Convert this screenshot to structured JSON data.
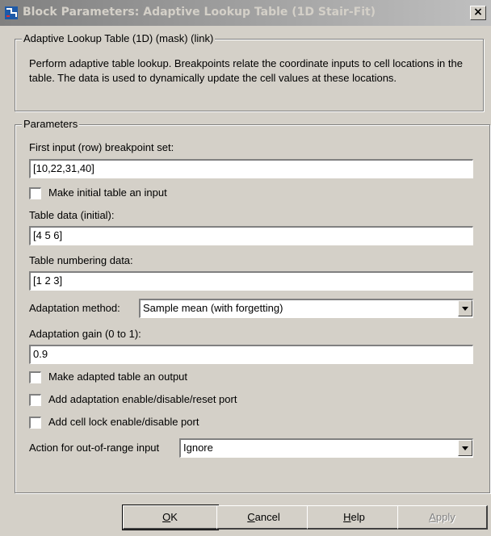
{
  "window": {
    "title": "Block Parameters: Adaptive Lookup Table (1D Stair-Fit)",
    "close_icon": "close-icon"
  },
  "description_group": {
    "legend": "Adaptive Lookup Table (1D) (mask) (link)",
    "text": "Perform adaptive table lookup.  Breakpoints relate the coordinate inputs to cell locations in the table.  The data is used to dynamically update the cell values at these locations."
  },
  "parameters": {
    "legend": "Parameters",
    "breakpoints": {
      "label": "First input (row) breakpoint set:",
      "value": "[10,22,31,40]"
    },
    "table_input_checkbox": {
      "label": "Make initial table an input",
      "checked": false
    },
    "table_data": {
      "label": "Table data (initial):",
      "value": "[4 5 6]"
    },
    "table_numbering": {
      "label": "Table numbering data:",
      "value": "[1 2 3]"
    },
    "adaptation_method": {
      "label": "Adaptation method:",
      "value": "Sample mean (with forgetting)"
    },
    "adaptation_gain": {
      "label": "Adaptation gain (0 to 1):",
      "value": "0.9"
    },
    "adapted_output_checkbox": {
      "label": "Make adapted table an output",
      "checked": false
    },
    "enable_port_checkbox": {
      "label": "Add adaptation enable/disable/reset port",
      "checked": false
    },
    "cell_lock_checkbox": {
      "label": "Add cell lock enable/disable port",
      "checked": false
    },
    "out_of_range": {
      "label": "Action for out-of-range input",
      "value": "Ignore"
    }
  },
  "buttons": {
    "ok": {
      "mnemonic": "O",
      "rest": "K"
    },
    "cancel": {
      "mnemonic": "C",
      "rest": "ancel"
    },
    "help": {
      "mnemonic": "H",
      "rest": "elp"
    },
    "apply": {
      "mnemonic": "A",
      "rest": "pply",
      "disabled": true
    }
  },
  "colors": {
    "dialog_bg": "#d4d0c8",
    "title_gradient_start": "#808080",
    "title_gradient_end": "#c0c0c0"
  }
}
